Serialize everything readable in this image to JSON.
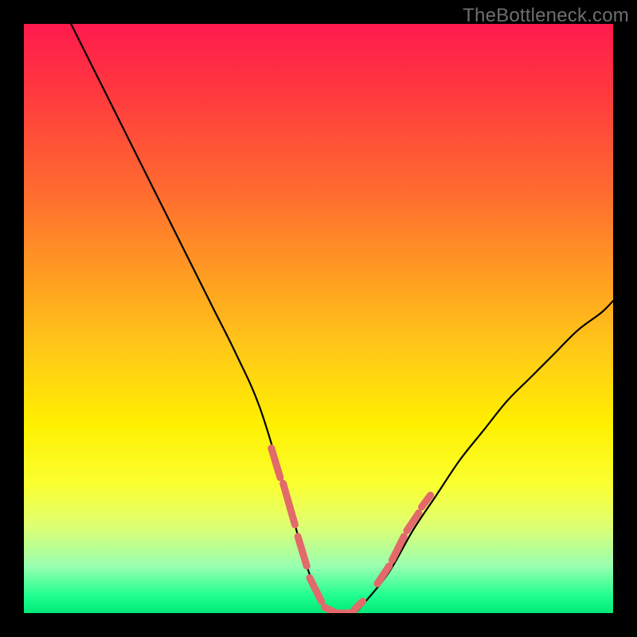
{
  "watermark": "TheBottleneck.com",
  "chart_data": {
    "type": "line",
    "note": "Bottleneck curve chart. X axis = component score (0–100, unlabeled). Y axis = bottleneck percentage (0–100, unlabeled). Background gradient: red (top, high bottleneck) → green (bottom, 0% bottleneck). Black curve shows bottleneck % vs score; dashed salmon segments mark recommended-range markers near the minimum.",
    "title": "",
    "xlabel": "",
    "ylabel": "",
    "xlim": [
      0,
      100
    ],
    "ylim": [
      0,
      100
    ],
    "series": [
      {
        "name": "bottleneck-curve",
        "x": [
          8,
          12,
          16,
          20,
          24,
          28,
          32,
          36,
          40,
          44,
          46,
          48,
          50,
          52,
          54,
          56,
          58,
          62,
          66,
          70,
          74,
          78,
          82,
          86,
          90,
          94,
          98,
          100
        ],
        "y": [
          100,
          92,
          84,
          76,
          68,
          60,
          52,
          44,
          35,
          22,
          15,
          8,
          3,
          0,
          0,
          0,
          2,
          7,
          14,
          20,
          26,
          31,
          36,
          40,
          44,
          48,
          51,
          53
        ]
      }
    ],
    "highlight_segments": {
      "name": "recommended-range-dashes",
      "color": "#e26a6a",
      "segments": [
        {
          "x": [
            42,
            43.5
          ],
          "y": [
            28,
            23
          ]
        },
        {
          "x": [
            44,
            46
          ],
          "y": [
            22,
            15
          ]
        },
        {
          "x": [
            46.5,
            48
          ],
          "y": [
            13,
            8
          ]
        },
        {
          "x": [
            48.5,
            50.5
          ],
          "y": [
            6,
            2
          ]
        },
        {
          "x": [
            51,
            53
          ],
          "y": [
            1,
            0
          ]
        },
        {
          "x": [
            53.5,
            55.5
          ],
          "y": [
            0,
            0
          ]
        },
        {
          "x": [
            56,
            57.5
          ],
          "y": [
            0.5,
            2
          ]
        },
        {
          "x": [
            60,
            62
          ],
          "y": [
            5,
            8
          ]
        },
        {
          "x": [
            62.5,
            64.5
          ],
          "y": [
            9,
            13
          ]
        },
        {
          "x": [
            65,
            67
          ],
          "y": [
            14,
            17
          ]
        },
        {
          "x": [
            67.5,
            69
          ],
          "y": [
            18,
            20
          ]
        }
      ]
    }
  }
}
